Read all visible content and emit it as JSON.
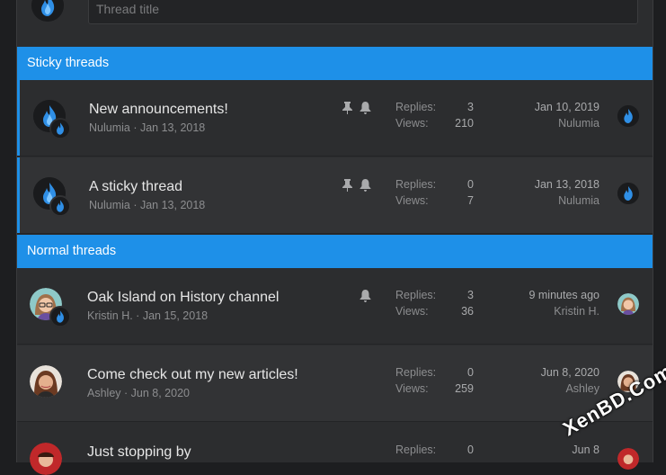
{
  "new_thread": {
    "placeholder": "Thread title"
  },
  "sections": {
    "sticky": "Sticky threads",
    "normal": "Normal threads"
  },
  "labels": {
    "replies": "Replies:",
    "views": "Views:"
  },
  "threads": [
    {
      "title": "New announcements!",
      "author": "Nulumia",
      "date": "Jan 13, 2018",
      "replies": "3",
      "views": "210",
      "last_date": "Jan 10, 2019",
      "last_user": "Nulumia",
      "pinned": true,
      "watched": true
    },
    {
      "title": "A sticky thread",
      "author": "Nulumia",
      "date": "Jan 13, 2018",
      "replies": "0",
      "views": "7",
      "last_date": "Jan 13, 2018",
      "last_user": "Nulumia",
      "pinned": true,
      "watched": true
    },
    {
      "title": "Oak Island on History channel",
      "author": "Kristin H.",
      "date": "Jan 15, 2018",
      "replies": "3",
      "views": "36",
      "last_date": "9 minutes ago",
      "last_user": "Kristin H.",
      "pinned": false,
      "watched": true
    },
    {
      "title": "Come check out my new articles!",
      "author": "Ashley",
      "date": "Jun 8, 2020",
      "replies": "0",
      "views": "259",
      "last_date": "Jun 8, 2020",
      "last_user": "Ashley",
      "pinned": false,
      "watched": false
    },
    {
      "title": "Just stopping by",
      "author": "",
      "date": "",
      "replies": "0",
      "views": "",
      "last_date": "Jun 8",
      "last_user": "",
      "pinned": false,
      "watched": false
    }
  ],
  "meta_sep": " · ",
  "watermark": "XenBD.Com",
  "colors": {
    "accent": "#1e90e8",
    "row": "#2c2d2f",
    "row_alt": "#323335"
  }
}
